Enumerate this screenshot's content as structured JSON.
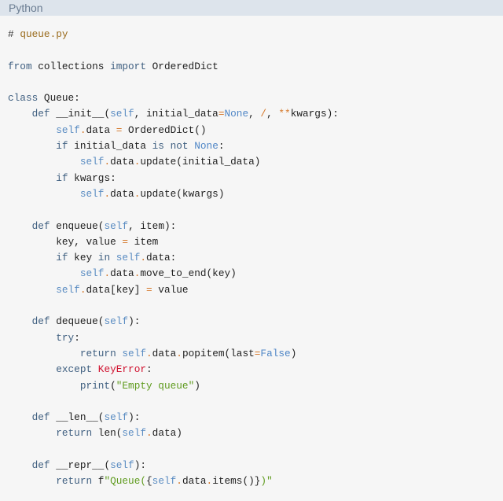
{
  "header": {
    "language": "Python"
  },
  "code": {
    "lines": [
      [
        [
          "h",
          "# "
        ],
        [
          "cm",
          "queue.py"
        ]
      ],
      [],
      [
        [
          "k",
          "from"
        ],
        [
          "p",
          " collections "
        ],
        [
          "k",
          "import"
        ],
        [
          "p",
          " OrderedDict"
        ]
      ],
      [],
      [
        [
          "k",
          "class"
        ],
        [
          "p",
          " Queue:"
        ]
      ],
      [
        [
          "p",
          "    "
        ],
        [
          "k",
          "def"
        ],
        [
          "p",
          " __init__("
        ],
        [
          "s",
          "self"
        ],
        [
          "p",
          ", initial_data"
        ],
        [
          "o",
          "="
        ],
        [
          "c",
          "None"
        ],
        [
          "p",
          ", "
        ],
        [
          "o",
          "/"
        ],
        [
          "p",
          ", "
        ],
        [
          "o",
          "**"
        ],
        [
          "p",
          "kwargs):"
        ]
      ],
      [
        [
          "p",
          "        "
        ],
        [
          "s",
          "self"
        ],
        [
          "o",
          "."
        ],
        [
          "p",
          "data "
        ],
        [
          "o",
          "="
        ],
        [
          "p",
          " OrderedDict()"
        ]
      ],
      [
        [
          "p",
          "        "
        ],
        [
          "k",
          "if"
        ],
        [
          "p",
          " initial_data "
        ],
        [
          "k",
          "is not"
        ],
        [
          "p",
          " "
        ],
        [
          "c",
          "None"
        ],
        [
          "p",
          ":"
        ]
      ],
      [
        [
          "p",
          "            "
        ],
        [
          "s",
          "self"
        ],
        [
          "o",
          "."
        ],
        [
          "p",
          "data"
        ],
        [
          "o",
          "."
        ],
        [
          "p",
          "update(initial_data)"
        ]
      ],
      [
        [
          "p",
          "        "
        ],
        [
          "k",
          "if"
        ],
        [
          "p",
          " kwargs:"
        ]
      ],
      [
        [
          "p",
          "            "
        ],
        [
          "s",
          "self"
        ],
        [
          "o",
          "."
        ],
        [
          "p",
          "data"
        ],
        [
          "o",
          "."
        ],
        [
          "p",
          "update(kwargs)"
        ]
      ],
      [],
      [
        [
          "p",
          "    "
        ],
        [
          "k",
          "def"
        ],
        [
          "p",
          " enqueue("
        ],
        [
          "s",
          "self"
        ],
        [
          "p",
          ", item):"
        ]
      ],
      [
        [
          "p",
          "        key, value "
        ],
        [
          "o",
          "="
        ],
        [
          "p",
          " item"
        ]
      ],
      [
        [
          "p",
          "        "
        ],
        [
          "k",
          "if"
        ],
        [
          "p",
          " key "
        ],
        [
          "k",
          "in"
        ],
        [
          "p",
          " "
        ],
        [
          "s",
          "self"
        ],
        [
          "o",
          "."
        ],
        [
          "p",
          "data:"
        ]
      ],
      [
        [
          "p",
          "            "
        ],
        [
          "s",
          "self"
        ],
        [
          "o",
          "."
        ],
        [
          "p",
          "data"
        ],
        [
          "o",
          "."
        ],
        [
          "p",
          "move_to_end(key)"
        ]
      ],
      [
        [
          "p",
          "        "
        ],
        [
          "s",
          "self"
        ],
        [
          "o",
          "."
        ],
        [
          "p",
          "data[key] "
        ],
        [
          "o",
          "="
        ],
        [
          "p",
          " value"
        ]
      ],
      [],
      [
        [
          "p",
          "    "
        ],
        [
          "k",
          "def"
        ],
        [
          "p",
          " dequeue("
        ],
        [
          "s",
          "self"
        ],
        [
          "p",
          "):"
        ]
      ],
      [
        [
          "p",
          "        "
        ],
        [
          "k",
          "try"
        ],
        [
          "p",
          ":"
        ]
      ],
      [
        [
          "p",
          "            "
        ],
        [
          "k",
          "return"
        ],
        [
          "p",
          " "
        ],
        [
          "s",
          "self"
        ],
        [
          "o",
          "."
        ],
        [
          "p",
          "data"
        ],
        [
          "o",
          "."
        ],
        [
          "p",
          "popitem(last"
        ],
        [
          "o",
          "="
        ],
        [
          "c",
          "False"
        ],
        [
          "p",
          ")"
        ]
      ],
      [
        [
          "p",
          "        "
        ],
        [
          "k",
          "except"
        ],
        [
          "p",
          " "
        ],
        [
          "e",
          "KeyError"
        ],
        [
          "p",
          ":"
        ]
      ],
      [
        [
          "p",
          "            "
        ],
        [
          "k",
          "print"
        ],
        [
          "p",
          "("
        ],
        [
          "str",
          "\"Empty queue\""
        ],
        [
          "p",
          ")"
        ]
      ],
      [],
      [
        [
          "p",
          "    "
        ],
        [
          "k",
          "def"
        ],
        [
          "p",
          " __len__("
        ],
        [
          "s",
          "self"
        ],
        [
          "p",
          "):"
        ]
      ],
      [
        [
          "p",
          "        "
        ],
        [
          "k",
          "return"
        ],
        [
          "p",
          " len("
        ],
        [
          "s",
          "self"
        ],
        [
          "o",
          "."
        ],
        [
          "p",
          "data)"
        ]
      ],
      [],
      [
        [
          "p",
          "    "
        ],
        [
          "k",
          "def"
        ],
        [
          "p",
          " __repr__("
        ],
        [
          "s",
          "self"
        ],
        [
          "p",
          "):"
        ]
      ],
      [
        [
          "p",
          "        "
        ],
        [
          "k",
          "return"
        ],
        [
          "p",
          " f"
        ],
        [
          "str",
          "\"Queue("
        ],
        [
          "p",
          "{"
        ],
        [
          "s",
          "self"
        ],
        [
          "o",
          "."
        ],
        [
          "p",
          "data"
        ],
        [
          "o",
          "."
        ],
        [
          "p",
          "items()}"
        ],
        [
          "str",
          ")\""
        ]
      ]
    ]
  }
}
